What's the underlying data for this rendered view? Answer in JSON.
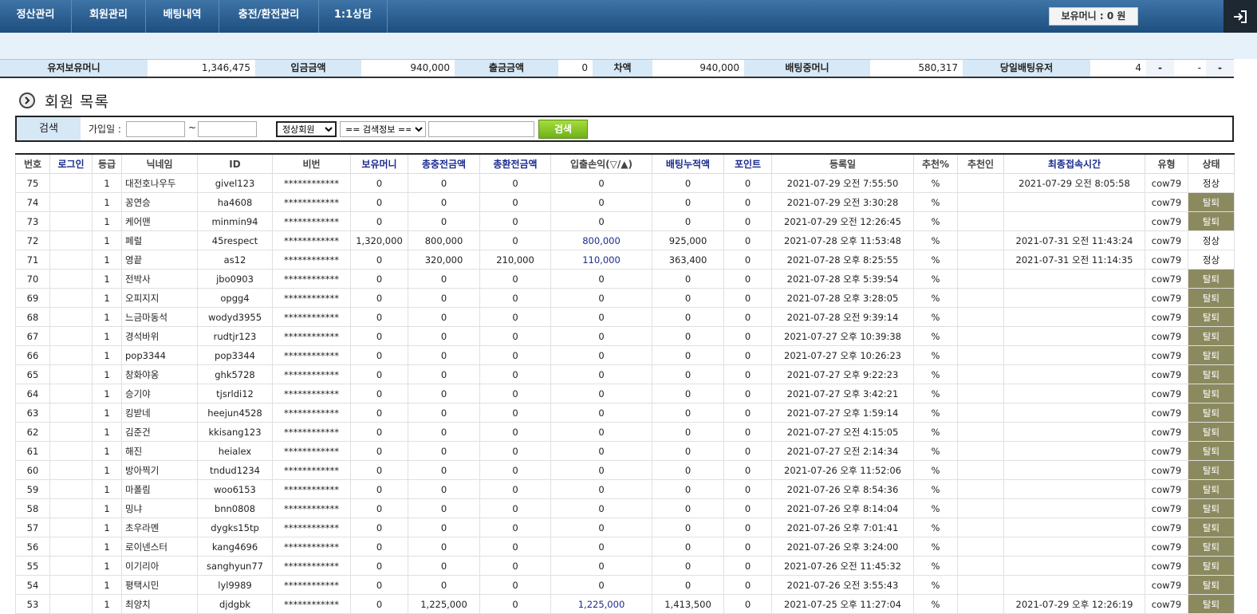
{
  "nav": {
    "items": [
      "정산관리",
      "회원관리",
      "배팅내역",
      "충전/환전관리",
      "1:1상담"
    ],
    "money_label": "보유머니 : 0 원"
  },
  "summary": {
    "cells": [
      {
        "label": "유저보유머니",
        "value": "1,346,475"
      },
      {
        "label": "입금금액",
        "value": "940,000"
      },
      {
        "label": "출금금액",
        "value": "0"
      },
      {
        "label": "차액",
        "value": "940,000"
      },
      {
        "label": "배팅중머니",
        "value": "580,317"
      },
      {
        "label": "당일배팅유저",
        "value": "4"
      }
    ],
    "extra": [
      "-",
      "-",
      "-"
    ]
  },
  "page_title": "회원 목록",
  "search": {
    "label": "검색",
    "join_label": "가입일 :",
    "tilde": "~",
    "member_select": "정상회원",
    "info_select": "== 검색정보 ==",
    "button": "검색"
  },
  "table": {
    "headers": [
      "번호",
      "로그인",
      "등급",
      "닉네임",
      "ID",
      "비번",
      "보유머니",
      "총충전금액",
      "총환전금액",
      "입출손익(▽/▲)",
      "배팅누적액",
      "포인트",
      "등록일",
      "추천%",
      "추천인",
      "최종접속시간",
      "유형",
      "상태"
    ],
    "rows": [
      [
        "75",
        "",
        "1",
        "대전호나우두",
        "givel123",
        "************",
        "0",
        "0",
        "0",
        "0",
        "0",
        "0",
        "2021-07-29 오전 7:55:50",
        "%",
        "",
        "2021-07-29 오전 8:05:58",
        "cow79",
        "정상"
      ],
      [
        "74",
        "",
        "1",
        "꽁연승",
        "ha4608",
        "************",
        "0",
        "0",
        "0",
        "0",
        "0",
        "0",
        "2021-07-29 오전 3:30:28",
        "%",
        "",
        "",
        "cow79",
        "탈퇴"
      ],
      [
        "73",
        "",
        "1",
        "케어맨",
        "minmin94",
        "************",
        "0",
        "0",
        "0",
        "0",
        "0",
        "0",
        "2021-07-29 오전 12:26:45",
        "%",
        "",
        "",
        "cow79",
        "탈퇴"
      ],
      [
        "72",
        "",
        "1",
        "페럴",
        "45respect",
        "************",
        "1,320,000",
        "800,000",
        "0",
        "800,000",
        "925,000",
        "0",
        "2021-07-28 오후 11:53:48",
        "%",
        "",
        "2021-07-31 오전 11:43:24",
        "cow79",
        "정상"
      ],
      [
        "71",
        "",
        "1",
        "영끝",
        "as12",
        "************",
        "0",
        "320,000",
        "210,000",
        "110,000",
        "363,400",
        "0",
        "2021-07-28 오후 8:25:55",
        "%",
        "",
        "2021-07-31 오전 11:14:35",
        "cow79",
        "정상"
      ],
      [
        "70",
        "",
        "1",
        "전박사",
        "jbo0903",
        "************",
        "0",
        "0",
        "0",
        "0",
        "0",
        "0",
        "2021-07-28 오후 5:39:54",
        "%",
        "",
        "",
        "cow79",
        "탈퇴"
      ],
      [
        "69",
        "",
        "1",
        "오피지지",
        "opgg4",
        "************",
        "0",
        "0",
        "0",
        "0",
        "0",
        "0",
        "2021-07-28 오후 3:28:05",
        "%",
        "",
        "",
        "cow79",
        "탈퇴"
      ],
      [
        "68",
        "",
        "1",
        "느금마동석",
        "wodyd3955",
        "************",
        "0",
        "0",
        "0",
        "0",
        "0",
        "0",
        "2021-07-28 오전 9:39:14",
        "%",
        "",
        "",
        "cow79",
        "탈퇴"
      ],
      [
        "67",
        "",
        "1",
        "경석바위",
        "rudtjr123",
        "************",
        "0",
        "0",
        "0",
        "0",
        "0",
        "0",
        "2021-07-27 오후 10:39:38",
        "%",
        "",
        "",
        "cow79",
        "탈퇴"
      ],
      [
        "66",
        "",
        "1",
        "pop3344",
        "pop3344",
        "************",
        "0",
        "0",
        "0",
        "0",
        "0",
        "0",
        "2021-07-27 오후 10:26:23",
        "%",
        "",
        "",
        "cow79",
        "탈퇴"
      ],
      [
        "65",
        "",
        "1",
        "창화야옹",
        "ghk5728",
        "************",
        "0",
        "0",
        "0",
        "0",
        "0",
        "0",
        "2021-07-27 오후 9:22:23",
        "%",
        "",
        "",
        "cow79",
        "탈퇴"
      ],
      [
        "64",
        "",
        "1",
        "승기야",
        "tjsrldi12",
        "************",
        "0",
        "0",
        "0",
        "0",
        "0",
        "0",
        "2021-07-27 오후 3:42:21",
        "%",
        "",
        "",
        "cow79",
        "탈퇴"
      ],
      [
        "63",
        "",
        "1",
        "킹받네",
        "heejun4528",
        "************",
        "0",
        "0",
        "0",
        "0",
        "0",
        "0",
        "2021-07-27 오후 1:59:14",
        "%",
        "",
        "",
        "cow79",
        "탈퇴"
      ],
      [
        "62",
        "",
        "1",
        "김준건",
        "kkisang123",
        "************",
        "0",
        "0",
        "0",
        "0",
        "0",
        "0",
        "2021-07-27 오전 4:15:05",
        "%",
        "",
        "",
        "cow79",
        "탈퇴"
      ],
      [
        "61",
        "",
        "1",
        "해진",
        "heialex",
        "************",
        "0",
        "0",
        "0",
        "0",
        "0",
        "0",
        "2021-07-27 오전 2:14:34",
        "%",
        "",
        "",
        "cow79",
        "탈퇴"
      ],
      [
        "60",
        "",
        "1",
        "방아찍기",
        "tndud1234",
        "************",
        "0",
        "0",
        "0",
        "0",
        "0",
        "0",
        "2021-07-26 오후 11:52:06",
        "%",
        "",
        "",
        "cow79",
        "탈퇴"
      ],
      [
        "59",
        "",
        "1",
        "마폴림",
        "woo6153",
        "************",
        "0",
        "0",
        "0",
        "0",
        "0",
        "0",
        "2021-07-26 오후 8:54:36",
        "%",
        "",
        "",
        "cow79",
        "탈퇴"
      ],
      [
        "58",
        "",
        "1",
        "밍냐",
        "bnn0808",
        "************",
        "0",
        "0",
        "0",
        "0",
        "0",
        "0",
        "2021-07-26 오후 8:14:04",
        "%",
        "",
        "",
        "cow79",
        "탈퇴"
      ],
      [
        "57",
        "",
        "1",
        "초우라멘",
        "dygks15tp",
        "************",
        "0",
        "0",
        "0",
        "0",
        "0",
        "0",
        "2021-07-26 오후 7:01:41",
        "%",
        "",
        "",
        "cow79",
        "탈퇴"
      ],
      [
        "56",
        "",
        "1",
        "로이넨스터",
        "kang4696",
        "************",
        "0",
        "0",
        "0",
        "0",
        "0",
        "0",
        "2021-07-26 오후 3:24:00",
        "%",
        "",
        "",
        "cow79",
        "탈퇴"
      ],
      [
        "55",
        "",
        "1",
        "이기리아",
        "sanghyun77",
        "************",
        "0",
        "0",
        "0",
        "0",
        "0",
        "0",
        "2021-07-26 오전 11:45:32",
        "%",
        "",
        "",
        "cow79",
        "탈퇴"
      ],
      [
        "54",
        "",
        "1",
        "평택시민",
        "lyl9989",
        "************",
        "0",
        "0",
        "0",
        "0",
        "0",
        "0",
        "2021-07-26 오전 3:55:43",
        "%",
        "",
        "",
        "cow79",
        "탈퇴"
      ],
      [
        "53",
        "",
        "1",
        "최양치",
        "djdgbk",
        "************",
        "0",
        "1,225,000",
        "0",
        "1,225,000",
        "1,413,500",
        "0",
        "2021-07-25 오후 11:27:04",
        "%",
        "",
        "2021-07-29 오후 12:26:19",
        "cow79",
        "탈퇴"
      ]
    ]
  },
  "colors": {
    "nav_top": "#3f74a6",
    "nav_bottom": "#1d4e80",
    "status_out_bg": "#8b8a5f",
    "header_blue": "#1a2b8f",
    "search_btn": "#8ccb2c"
  }
}
